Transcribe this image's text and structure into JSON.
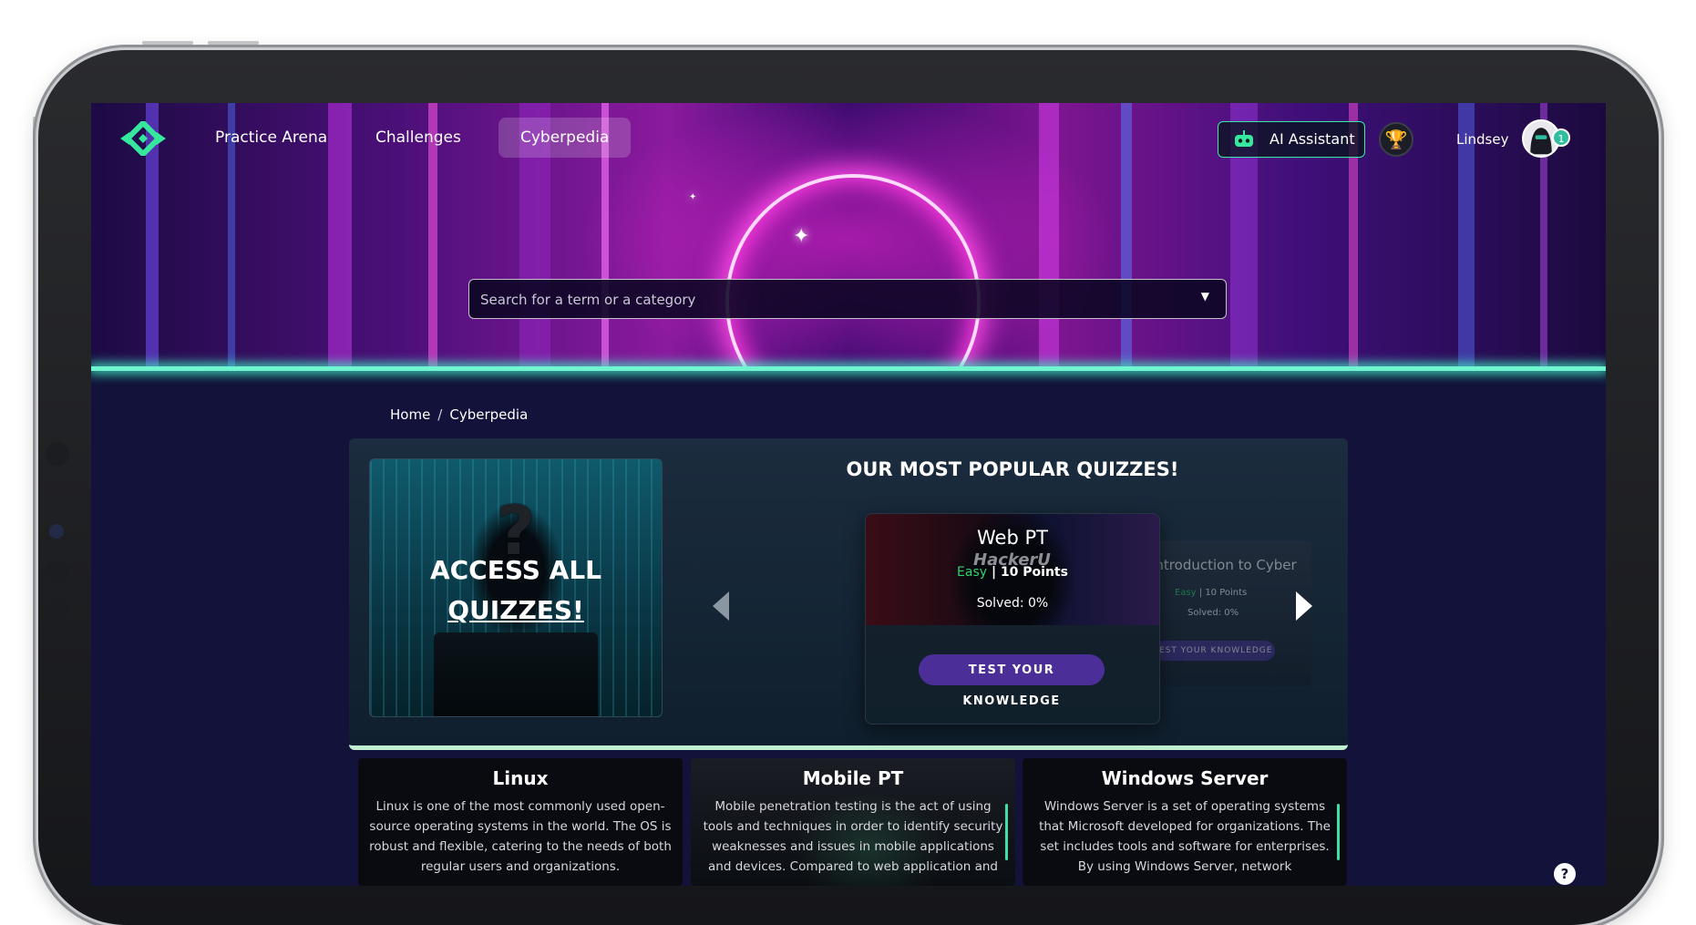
{
  "nav": {
    "items": [
      {
        "label": "Practice Arena"
      },
      {
        "label": "Challenges"
      },
      {
        "label": "Cyberpedia"
      }
    ],
    "active": "Cyberpedia",
    "ai_assistant_label": "AI Assistant",
    "user_name": "Lindsey",
    "notification_count": "1",
    "brand_color": "#3ee6a8"
  },
  "search": {
    "placeholder": "Search for a term or a category"
  },
  "breadcrumb": {
    "home": "Home",
    "separator": "/",
    "current": "Cyberpedia"
  },
  "access_card": {
    "line1": "ACCESS ALL",
    "line2": "QUIZZES!",
    "question_mark": "?"
  },
  "popular": {
    "title": "OUR MOST POPULAR QUIZZES!",
    "active_quiz": {
      "title": "Web PT",
      "brand": "HackerU",
      "difficulty": "Easy",
      "points": "| 10 Points",
      "solved": "Solved: 0%",
      "button": "TEST YOUR KNOWLEDGE"
    },
    "next_quiz": {
      "title": "Introduction to Cyber",
      "difficulty": "Easy",
      "points": "| 10 Points",
      "solved": "Solved: 0%",
      "button": "TEST YOUR KNOWLEDGE"
    }
  },
  "topics": [
    {
      "title": "Linux",
      "description": "Linux is one of the most commonly used open-source operating systems in the world. The OS is robust and flexible, catering to the needs of both regular users and organizations."
    },
    {
      "title": "Mobile PT",
      "description": "Mobile penetration testing is the act of using tools and techniques in order to identify security weaknesses and issues in mobile applications and devices. Compared to web application and"
    },
    {
      "title": "Windows Server",
      "description": "Windows Server is a set of operating systems that Microsoft developed for organizations. The set includes tools and software for enterprises. By using Windows Server, network"
    }
  ],
  "help_label": "?"
}
